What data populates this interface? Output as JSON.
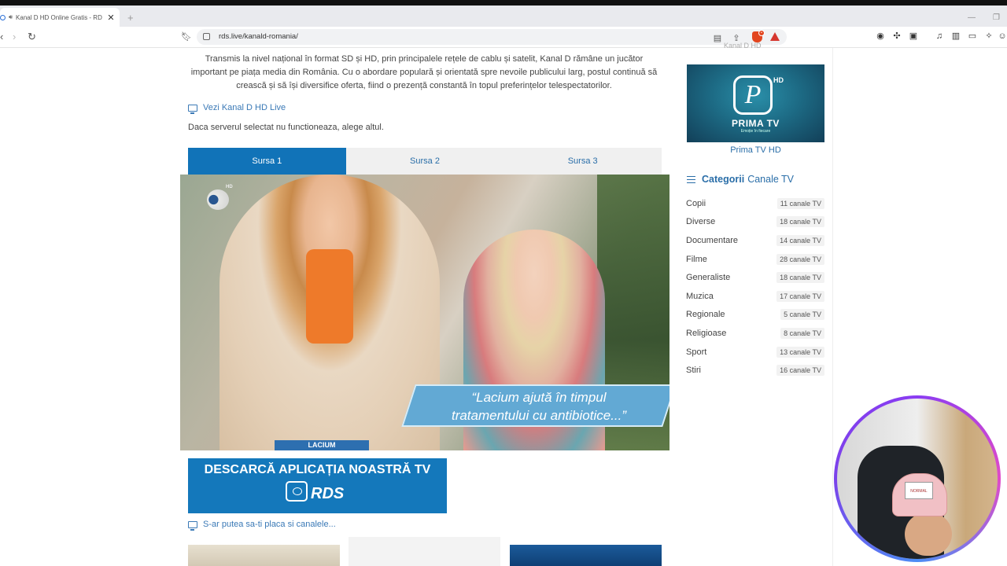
{
  "browser": {
    "tab_title": "Kanal D HD Online Gratis - RD",
    "tab_close": "✕",
    "new_tab": "+",
    "url": "rds.live/kanald-romania/"
  },
  "page": {
    "intro": "Transmis la nivel național în format SD și HD, prin principalele rețele de cablu și satelit, Kanal D rămâne un jucător important pe piața media din România. Cu o abordare populară și orientată spre nevoile publicului larg, postul continuă să crească și să își diversifice oferta, fiind o prezență constantă în topul preferințelor telespectatorilor.",
    "live_link": "Vezi Kanal D HD Live",
    "server_note": "Daca serverul selectat nu functioneaza, alege altul.",
    "source_tabs": [
      "Sursa 1",
      "Sursa 2",
      "Sursa 3"
    ],
    "video": {
      "caption_line1": "“Lacium ajută în timpul",
      "caption_line2": "tratamentului cu antibiotice...”",
      "channel_hd": "HD",
      "bottom_banner": "LACIUM"
    },
    "app_banner": {
      "headline": "DESCARCĂ APLICAȚIA NOASTRĂ TV",
      "brand": "RDS"
    },
    "suggest_link": "S-ar putea sa-ti placa si canalele..."
  },
  "sidebar": {
    "prev_label": "Kanal D HD",
    "featured": {
      "logo_letter": "P",
      "logo_hd": "HD",
      "logo_word": "PRIMA TV",
      "logo_sub": "Emoție în fiecare",
      "title": "Prima TV HD"
    },
    "categories_heading_bold": "Categorii",
    "categories_heading_rest": "Canale TV",
    "categories": [
      {
        "name": "Copii",
        "count": "11 canale TV"
      },
      {
        "name": "Diverse",
        "count": "18 canale TV"
      },
      {
        "name": "Documentare",
        "count": "14 canale TV"
      },
      {
        "name": "Filme",
        "count": "28 canale TV"
      },
      {
        "name": "Generaliste",
        "count": "18 canale TV"
      },
      {
        "name": "Muzica",
        "count": "17 canale TV"
      },
      {
        "name": "Regionale",
        "count": "5 canale TV"
      },
      {
        "name": "Religioase",
        "count": "8 canale TV"
      },
      {
        "name": "Sport",
        "count": "13 canale TV"
      },
      {
        "name": "Stiri",
        "count": "16 canale TV"
      }
    ]
  },
  "webcam": {
    "cap_patch": "NORMAL"
  },
  "colors": {
    "accent_blue": "#1173b8",
    "link_blue": "#3a79b6",
    "brave_orange": "#e2451f"
  }
}
